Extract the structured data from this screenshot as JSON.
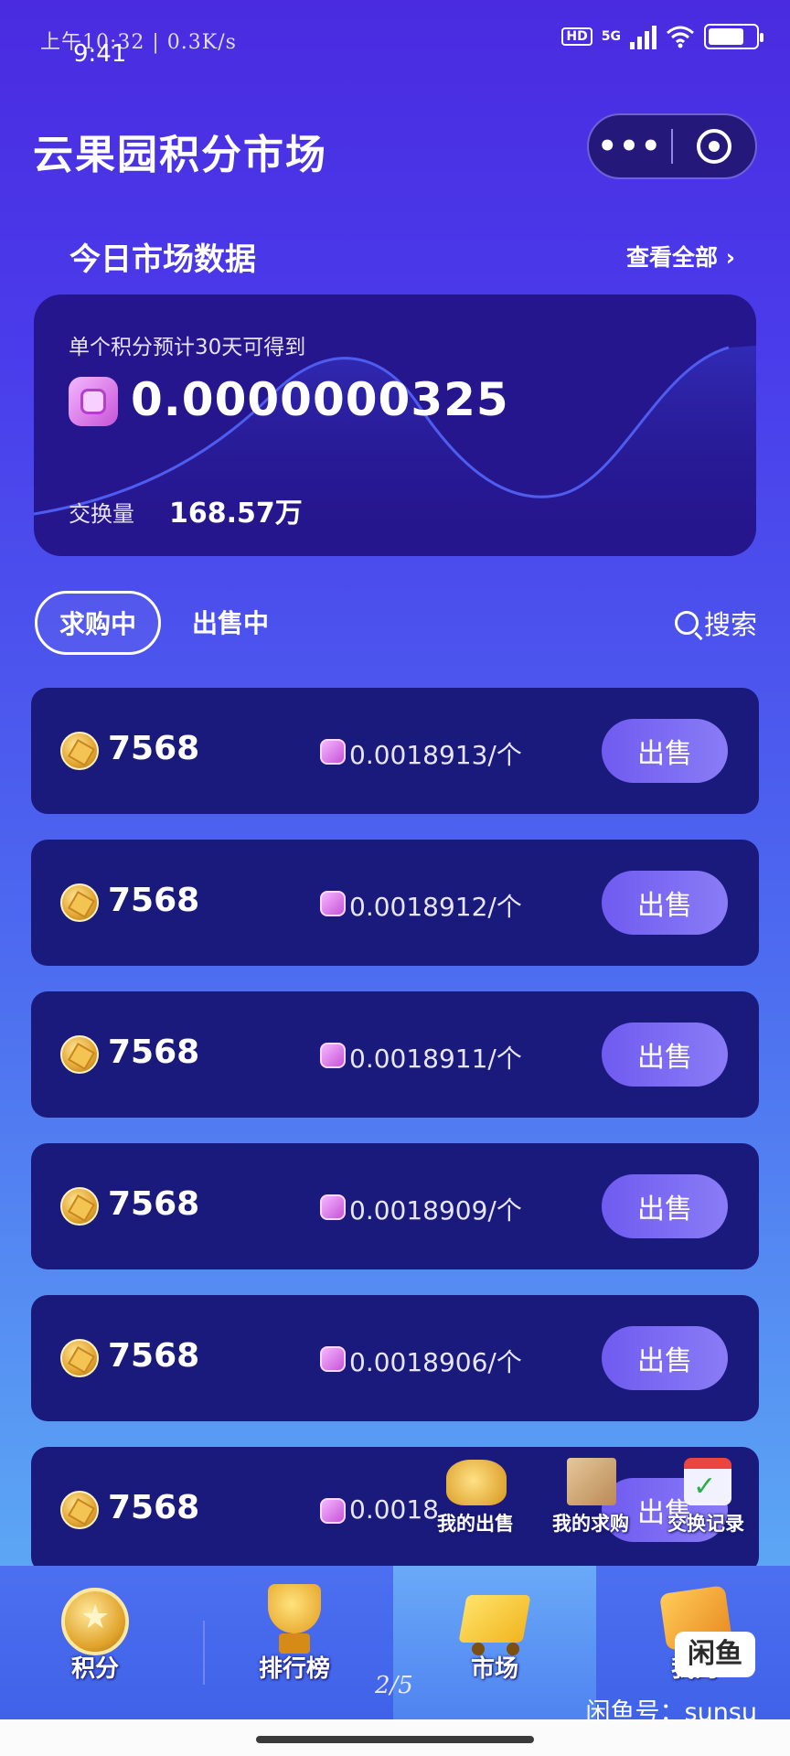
{
  "status_bar": {
    "handwritten_text": "上午10:32 | 0.3K/s",
    "time": "9:41",
    "hd": "HD",
    "network": "5G",
    "battery_level": 0.75
  },
  "header": {
    "title": "云果园积分市场",
    "more_icon": "more-dots-icon",
    "close_icon": "target-circle-icon"
  },
  "market": {
    "section_title": "今日市场数据",
    "view_all": "查看全部 ›",
    "card": {
      "label": "单个积分预计30天可得到",
      "value": "0.0000000325",
      "volume_label": "交换量",
      "volume_value": "168.57万"
    }
  },
  "tabs": {
    "buying": "求购中",
    "selling": "出售中",
    "search": "搜索"
  },
  "orders": [
    {
      "qty": "7568",
      "price": "0.0018913/个",
      "action": "出售"
    },
    {
      "qty": "7568",
      "price": "0.0018912/个",
      "action": "出售"
    },
    {
      "qty": "7568",
      "price": "0.0018911/个",
      "action": "出售"
    },
    {
      "qty": "7568",
      "price": "0.0018909/个",
      "action": "出售"
    },
    {
      "qty": "7568",
      "price": "0.0018906/个",
      "action": "出售"
    },
    {
      "qty": "7568",
      "price": "0.0018",
      "action": "出售"
    }
  ],
  "floating_menu": [
    {
      "label": "我的出售",
      "icon": "money-bag-icon"
    },
    {
      "label": "我的求购",
      "icon": "box-icon"
    },
    {
      "label": "交换记录",
      "icon": "calendar-check-icon"
    }
  ],
  "bottom_nav": [
    {
      "label": "积分",
      "icon": "points-medal-icon"
    },
    {
      "label": "排行榜",
      "icon": "trophy-icon"
    },
    {
      "label": "市场",
      "icon": "cart-icon",
      "active": true
    },
    {
      "label": "我的",
      "icon": "wallet-icon"
    }
  ],
  "page_indicator": "2/5",
  "watermark": {
    "logo": "闲鱼",
    "text": "闲鱼号：sunsu"
  }
}
